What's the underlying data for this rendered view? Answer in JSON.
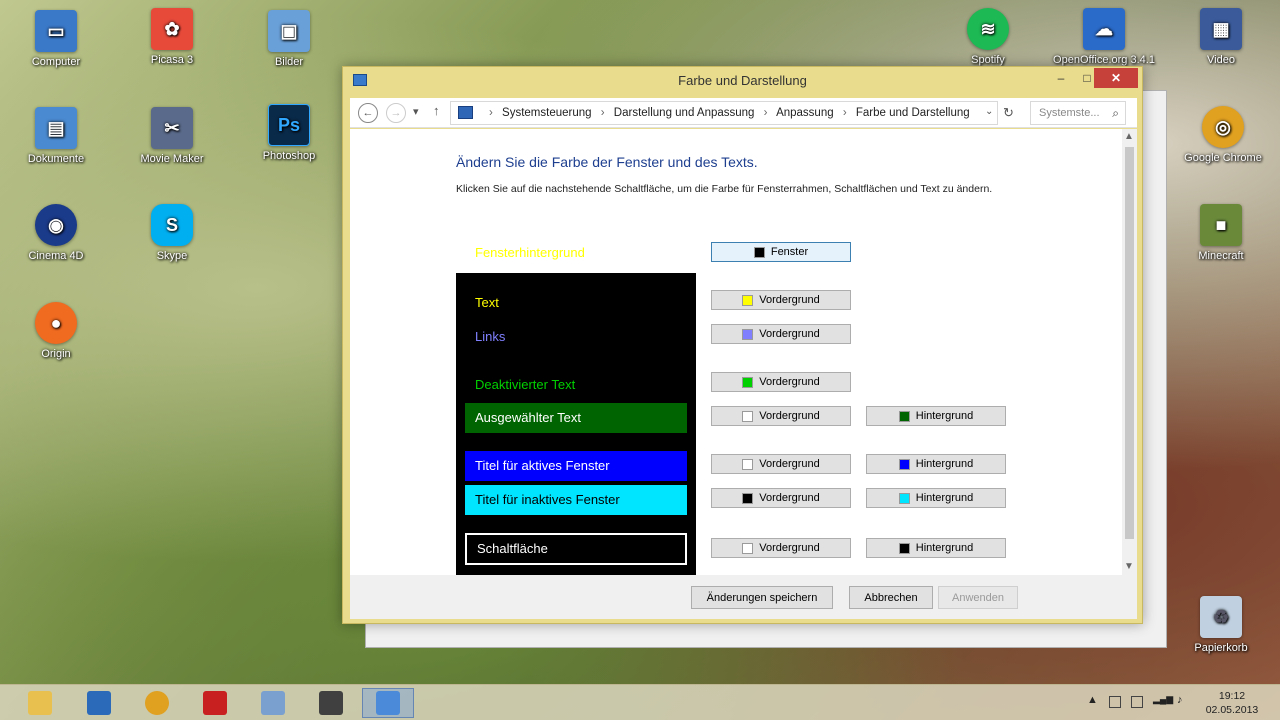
{
  "desktop": {
    "icons_left": [
      {
        "label": "Computer",
        "color": "#3a78c8"
      },
      {
        "label": "Picasa 3",
        "color": "#e84a3a"
      },
      {
        "label": "Bilder",
        "color": "#6aa0d8"
      },
      {
        "label": "Dokumente",
        "color": "#4a8ad0"
      },
      {
        "label": "Movie Maker",
        "color": "#5a6a8a"
      },
      {
        "label": "Photoshop",
        "color": "#0a2a4a"
      },
      {
        "label": "Cinema 4D",
        "color": "#1a3a8a"
      },
      {
        "label": "Skype",
        "color": "#00aff0"
      },
      {
        "label": "Origin",
        "color": "#f06a20"
      }
    ],
    "icons_right": [
      {
        "label": "Spotify",
        "color": "#1db954"
      },
      {
        "label": "OpenOffice.org 3.4.1",
        "color": "#2a6ac8"
      },
      {
        "label": "Video",
        "color": "#3a5a9a"
      },
      {
        "label": "Google Chrome",
        "color": "#e0a020"
      },
      {
        "label": "Minecraft",
        "color": "#6a8a3a"
      },
      {
        "label": "Papierkorb",
        "color": "#c0d0e0"
      }
    ]
  },
  "window": {
    "title": "Farbe und Darstellung",
    "controls": {
      "minimize": "–",
      "maximize": "□",
      "close": "✕"
    },
    "nav": {
      "back": "←",
      "forward": "→",
      "recent": "▾",
      "up": "↑",
      "breadcrumbs": [
        "Systemsteuerung",
        "Darstellung und Anpassung",
        "Anpassung",
        "Farbe und Darstellung"
      ],
      "separator": "›",
      "dropdown": "⌄",
      "refresh": "↻",
      "search_placeholder": "Systemste...",
      "search_icon": "⌕"
    },
    "heading": "Ändern Sie die Farbe der Fenster und des Texts.",
    "description": "Klicken Sie auf die nachstehende Schaltfläche, um die Farbe für Fensterrahmen, Schaltflächen und Text zu ändern.",
    "window_background_label": "Fensterhintergrund",
    "preview": {
      "text": "Text",
      "links": "Links",
      "disabled_text": "Deaktivierter Text",
      "selected_text": "Ausgewählter Text",
      "active_title": "Titel für aktives Fenster",
      "inactive_title": "Titel für inaktives Fenster",
      "button": "Schaltfläche"
    },
    "colors": {
      "window_bg": "#000000",
      "text": "#ffff00",
      "links": "#8080ff",
      "disabled": "#00d000",
      "selected_fg": "#ffffff",
      "selected_bg": "#006400",
      "active_title_fg": "#ffffff",
      "active_title_bg": "#0000ff",
      "inactive_title_fg": "#000000",
      "inactive_title_bg": "#00e5ff",
      "button_fg": "#ffffff",
      "button_bg": "#000000"
    },
    "buttons": {
      "window": "Fenster",
      "foreground": "Vordergrund",
      "background": "Hintergrund"
    },
    "footer": {
      "save": "Änderungen speichern",
      "cancel": "Abbrechen",
      "apply": "Anwenden"
    }
  },
  "taskbar": {
    "apps": [
      {
        "name": "explorer",
        "color": "#e8c050"
      },
      {
        "name": "control-panel",
        "color": "#2a6ab8"
      },
      {
        "name": "chrome",
        "color": "#e0a020"
      },
      {
        "name": "power",
        "color": "#c82020"
      },
      {
        "name": "picture",
        "color": "#7aa0d0"
      },
      {
        "name": "media",
        "color": "#404040"
      },
      {
        "name": "settings",
        "color": "#4a8ad8"
      }
    ],
    "tray": {
      "up": "▲",
      "volume": "♪",
      "signal": "▂▄▆"
    },
    "time": "19:12",
    "date": "02.05.2013"
  }
}
